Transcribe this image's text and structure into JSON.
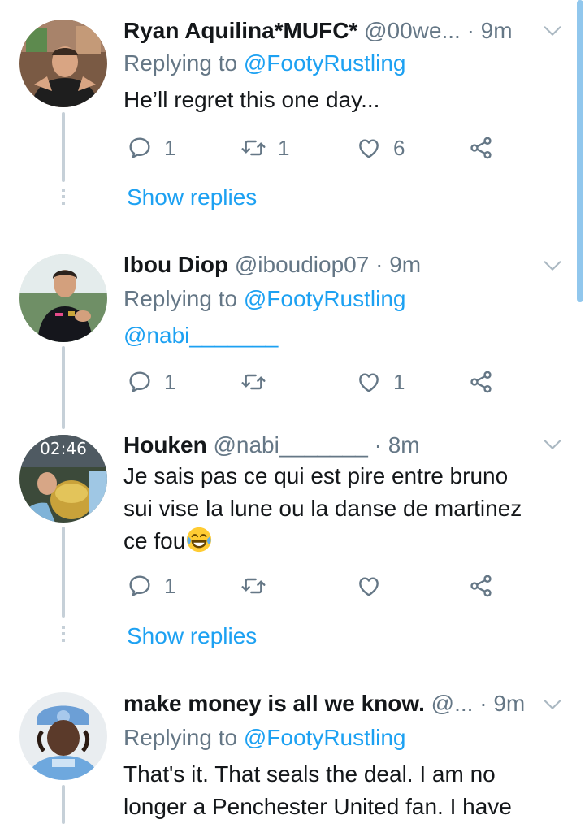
{
  "tweets": [
    {
      "name": "Ryan Aquilina*MUFC*",
      "handle": "@00we...",
      "time": "· 9m",
      "replying_label": "Replying to",
      "replying_user": "@FootyRustling",
      "text": "He’ll regret this one day...",
      "replies": "1",
      "retweets": "1",
      "likes": "6",
      "show_replies": "Show replies"
    },
    {
      "name": "Ibou Diop",
      "handle": "@iboudiop07",
      "time": "· 9m",
      "replying_label": "Replying to",
      "replying_user": "@FootyRustling",
      "text": "@nabi_______",
      "replies": "1",
      "retweets": "",
      "likes": "1"
    },
    {
      "name": "Houken",
      "handle": "@nabi_______",
      "time": "· 8m",
      "text_lines": [
        "Je sais pas ce qui est pire entre bruno",
        "sui vise la lune ou la danse de martinez",
        "ce fou"
      ],
      "avatar_clock": "02:46",
      "replies": "1",
      "retweets": "",
      "likes": "",
      "show_replies": "Show replies"
    },
    {
      "name": "make money is all we know.",
      "handle": "@...",
      "time": "· 9m",
      "replying_label": "Replying to",
      "replying_user": "@FootyRustling",
      "text_lines": [
        "That's it. That seals the deal. I am no",
        "longer a Penchester United fan. I have"
      ]
    }
  ],
  "colors": {
    "accent": "#1da1f2",
    "muted": "#657786",
    "thread_line": "#c6d0d8",
    "divider": "#e1e8ed"
  },
  "icons": [
    "reply-icon",
    "retweet-icon",
    "like-icon",
    "share-icon",
    "caret-down-icon",
    "laughing-emoji"
  ]
}
